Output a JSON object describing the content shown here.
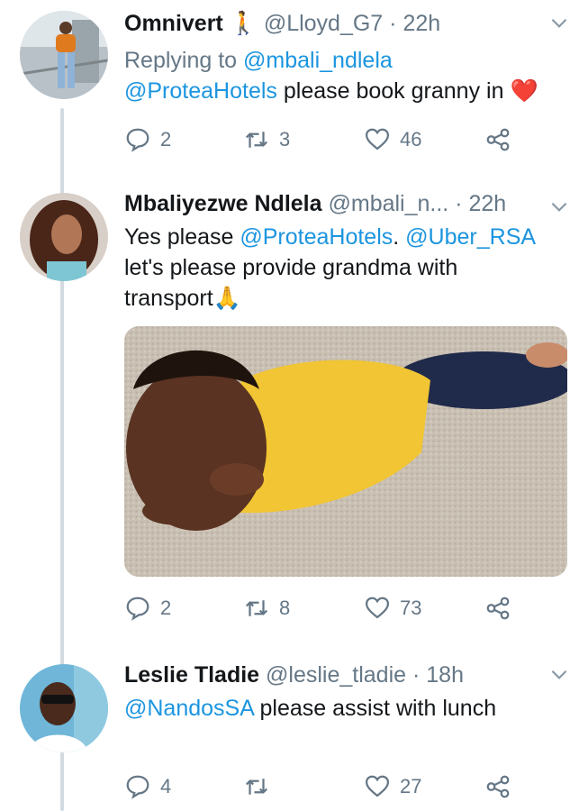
{
  "tweets": [
    {
      "name": "Omnivert",
      "emoji": "🚶",
      "handle": "@Lloyd_G7",
      "dot": "·",
      "time": "22h",
      "replying_prefix": "Replying to",
      "replying_to": "@mbali_ndlela",
      "mention": "@ProteaHotels",
      "text": "please book granny in",
      "text_emoji": "❤️",
      "replies": "2",
      "retweets": "3",
      "likes": "46"
    },
    {
      "name": "Mbaliyezwe Ndlela",
      "handle": "@mbali_n...",
      "dot": "·",
      "time": "22h",
      "line1_prefix": "Yes please",
      "mention1": "@ProteaHotels",
      "line1_mid": ".",
      "mention2": "@Uber_RSA",
      "line2": "let's please provide grandma with",
      "line3": "transport",
      "text_emoji": "🙏",
      "replies": "2",
      "retweets": "8",
      "likes": "73"
    },
    {
      "name": "Leslie Tladie",
      "handle": "@leslie_tladie",
      "dot": "·",
      "time": "18h",
      "mention": "@NandosSA",
      "text": "please assist with lunch",
      "replies": "4",
      "retweets": "",
      "likes": "27"
    }
  ],
  "colors": {
    "link": "#1b95e0",
    "secondary": "#657786",
    "thread_line": "#d4dbe0"
  },
  "icons": [
    "reply-icon",
    "retweet-icon",
    "like-icon",
    "share-icon",
    "chevron-down-icon"
  ]
}
